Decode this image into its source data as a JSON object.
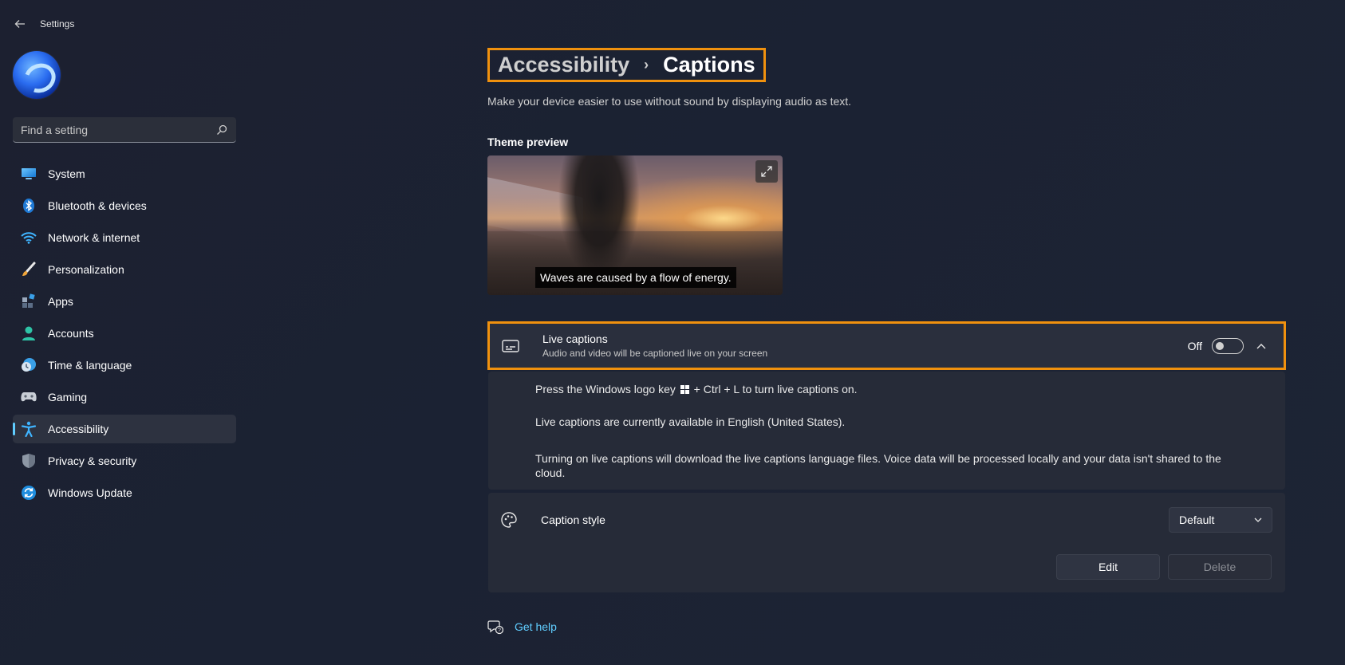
{
  "window": {
    "title": "Settings"
  },
  "search": {
    "placeholder": "Find a setting"
  },
  "sidebar": {
    "items": [
      {
        "label": "System",
        "icon": "monitor-icon"
      },
      {
        "label": "Bluetooth & devices",
        "icon": "bluetooth-icon"
      },
      {
        "label": "Network & internet",
        "icon": "wifi-icon"
      },
      {
        "label": "Personalization",
        "icon": "brush-icon"
      },
      {
        "label": "Apps",
        "icon": "apps-icon"
      },
      {
        "label": "Accounts",
        "icon": "person-icon"
      },
      {
        "label": "Time & language",
        "icon": "clock-globe-icon"
      },
      {
        "label": "Gaming",
        "icon": "gamepad-icon"
      },
      {
        "label": "Accessibility",
        "icon": "accessibility-icon",
        "active": true
      },
      {
        "label": "Privacy & security",
        "icon": "shield-icon"
      },
      {
        "label": "Windows Update",
        "icon": "refresh-icon"
      }
    ]
  },
  "breadcrumb": {
    "parent": "Accessibility",
    "current": "Captions"
  },
  "page": {
    "description": "Make your device easier to use without sound by displaying audio as text.",
    "preview_title": "Theme preview",
    "preview_caption": "Waves are caused by a flow of energy."
  },
  "live_captions": {
    "title": "Live captions",
    "subtitle": "Audio and video will be captioned live on your screen",
    "state_label": "Off",
    "enabled": false,
    "info_shortcut_before": "Press the Windows logo key",
    "info_shortcut_after": "+ Ctrl + L to turn live captions on.",
    "info_language": "Live captions are currently available in English (United States).",
    "info_download": "Turning on live captions will download the live captions language files. Voice data will be processed locally and your data isn't shared to the cloud."
  },
  "caption_style": {
    "title": "Caption style",
    "selected": "Default",
    "edit_label": "Edit",
    "delete_label": "Delete"
  },
  "help": {
    "label": "Get help"
  },
  "colors": {
    "accent": "#60cdff",
    "highlight": "#f0910e",
    "background": "#1c2131"
  }
}
